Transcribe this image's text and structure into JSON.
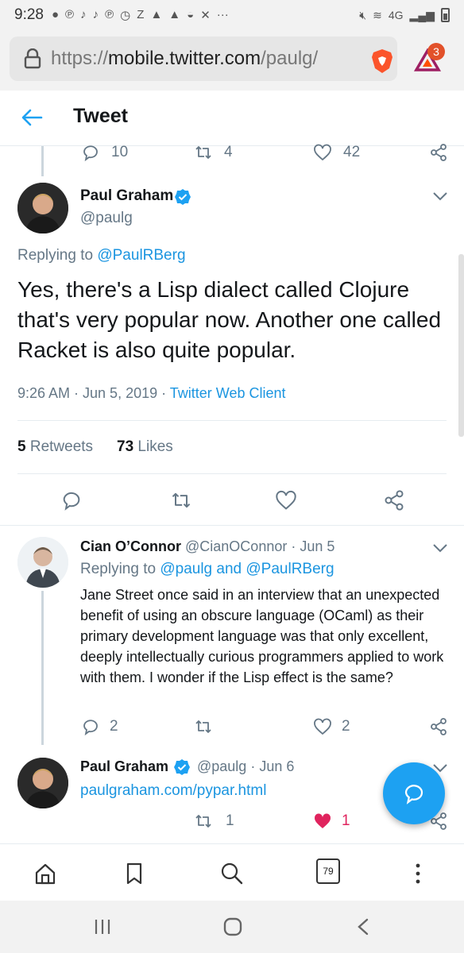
{
  "status_bar": {
    "time": "9:28",
    "network": "4G",
    "icons": [
      "message-icon",
      "pinterest-icon",
      "tiktok-icon",
      "tiktok-icon",
      "pinterest-icon",
      "timer-icon",
      "z-icon",
      "bell-icon",
      "bell-icon",
      "bowl-icon",
      "x-icon",
      "more-dots-icon"
    ]
  },
  "browser": {
    "url_prefix": "https://",
    "url_main": "mobile.twitter.com",
    "url_suffix": "/paulg/",
    "rewards_badge": "3"
  },
  "header": {
    "title": "Tweet"
  },
  "parent_actions": {
    "replies": "10",
    "retweets": "4",
    "likes": "42"
  },
  "main_tweet": {
    "author_name": "Paul Graham",
    "author_handle": "@paulg",
    "replying_label": "Replying to",
    "replying_to": "@PaulRBerg",
    "text": "Yes, there's a Lisp dialect called Clojure that's very popular now. Another one called Racket is also quite popular.",
    "time": "9:26 AM · Jun 5, 2019",
    "separator": " · ",
    "client": "Twitter Web Client",
    "retweets_count": "5",
    "retweets_label": "Retweets",
    "likes_count": "73",
    "likes_label": "Likes"
  },
  "reply1": {
    "author_name": "Cian O’Connor",
    "author_handle": "@CianOConnor",
    "date": "· Jun 5",
    "replying_label": "Replying to",
    "replying_to": "@paulg and @PaulRBerg",
    "text": "Jane Street once said in an interview that an unexpected benefit of using an obscure language (OCaml) as their primary development language was that only excellent, deeply intellectually curious programmers applied to work with them. I wonder if the Lisp effect is the same?",
    "replies": "2",
    "retweets": "",
    "likes": "2"
  },
  "reply2": {
    "author_name": "Paul Graham",
    "author_handle": "@paulg",
    "date": "· Jun 6",
    "link": "paulgraham.com/pypar.html",
    "retweets": "1",
    "likes": "1"
  },
  "bottom_nav": {
    "tab_count": "79"
  },
  "colors": {
    "accent": "#1da1f2",
    "link": "#1b95e0",
    "like": "#e0245e",
    "text": "#14171a",
    "muted": "#657786"
  }
}
